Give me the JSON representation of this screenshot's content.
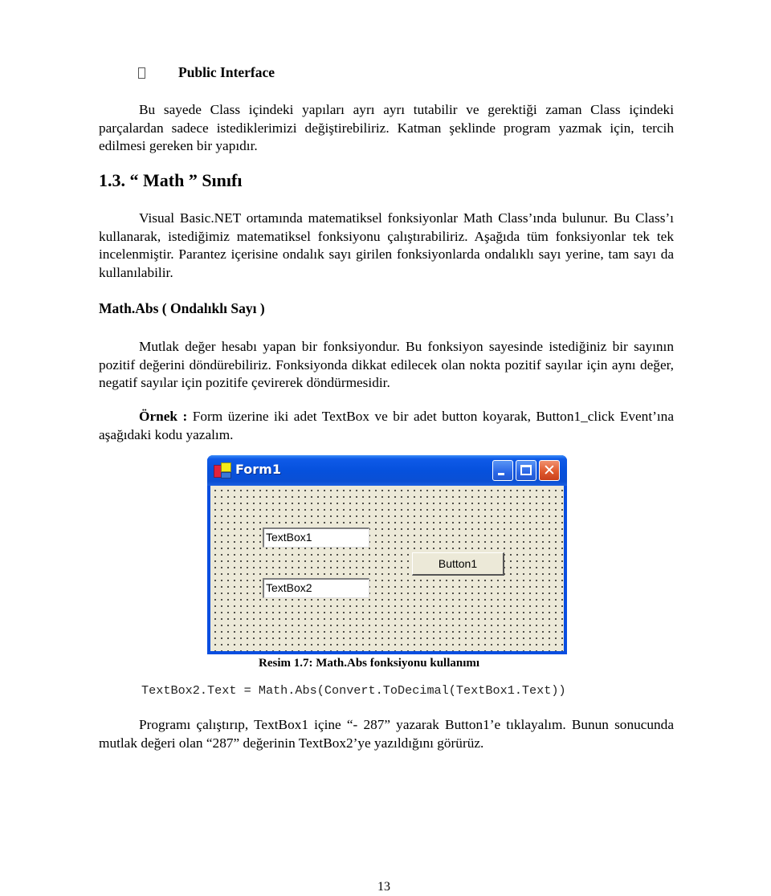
{
  "bullet": {
    "icon": "square-bullet-icon",
    "title": "Public Interface"
  },
  "paragraphs": {
    "intro": "Bu sayede Class içindeki yapıları ayrı ayrı tutabilir ve gerektiği zaman Class içindeki parçalardan sadece istediklerimizi değiştirebiliriz. Katman şeklinde program yazmak için, tercih edilmesi gereken bir yapıdır.",
    "math_class": "Visual Basic.NET ortamında matematiksel fonksiyonlar Math Class’ında bulunur. Bu Class’ı kullanarak, istediğimiz matematiksel fonksiyonu çalıştırabiliriz. Aşağıda tüm fonksiyonlar tek tek incelenmiştir. Parantez içerisine ondalık sayı girilen fonksiyonlarda ondalıklı sayı yerine, tam sayı da kullanılabilir.",
    "abs_desc": "Mutlak değer hesabı yapan bir fonksiyondur. Bu fonksiyon sayesinde istediğiniz bir sayının pozitif değerini döndürebiliriz. Fonksiyonda dikkat edilecek olan nokta pozitif sayılar için aynı değer, negatif sayılar için pozitife çevirerek döndürmesidir.",
    "example_label": "Örnek :",
    "example_text": " Form üzerine iki adet TextBox ve bir adet button koyarak, Button1_click Event’ına aşağıdaki kodu yazalım.",
    "result": "Programı çalıştırıp, TextBox1 içine “- 287” yazarak Button1’e tıklayalım. Bunun sonucunda mutlak değeri olan “287” değerinin TextBox2’ye yazıldığını görürüz."
  },
  "headings": {
    "section": "1.3. “ Math ” Sınıfı",
    "subsection": "Math.Abs ( Ondalıklı Sayı )"
  },
  "figure": {
    "window_title": "Form1",
    "app_icon": "form-app-icon",
    "controls": {
      "minimize_icon": "minimize-icon",
      "maximize_icon": "maximize-icon",
      "close_icon": "close-icon",
      "close_glyph": "✕"
    },
    "textbox1_value": "TextBox1",
    "textbox2_value": "TextBox2",
    "button1_label": "Button1",
    "colors": {
      "titlebar": "#0651dd",
      "client_bg": "#ece9d8",
      "close_button": "#e05a2e"
    },
    "caption": "Resim 1.7: Math.Abs fonksiyonu kullanımı"
  },
  "code": "TextBox2.Text = Math.Abs(Convert.ToDecimal(TextBox1.Text))",
  "page_number": "13"
}
